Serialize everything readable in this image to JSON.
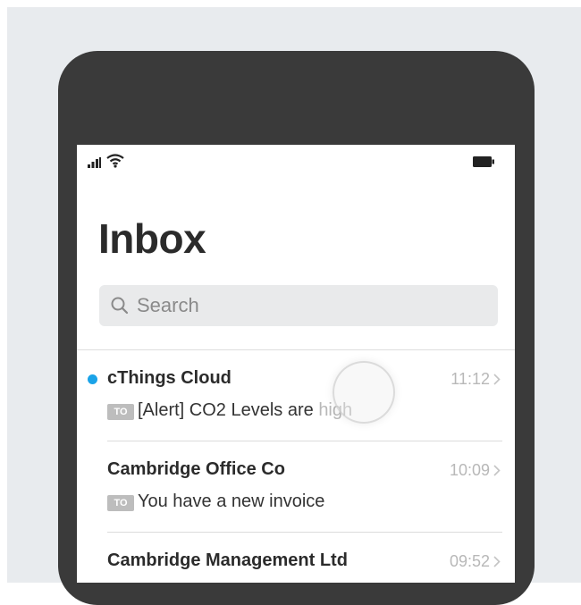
{
  "inbox": {
    "title": "Inbox",
    "search": {
      "placeholder": "Search"
    }
  },
  "emails": [
    {
      "sender": "cThings Cloud",
      "time": "11:12",
      "badge": "TO",
      "subject": "[Alert] CO2 Levels are ",
      "subject_faded": "high",
      "unread": true
    },
    {
      "sender": "Cambridge Office Co",
      "time": "10:09",
      "badge": "TO",
      "subject": "You have a new invoice",
      "unread": false
    },
    {
      "sender": "Cambridge Management Ltd",
      "time": "09:52",
      "unread": false
    }
  ],
  "colors": {
    "unread_dot": "#1aa3e8",
    "phone_frame": "#3a3a3a",
    "background": "#e8ebee"
  }
}
